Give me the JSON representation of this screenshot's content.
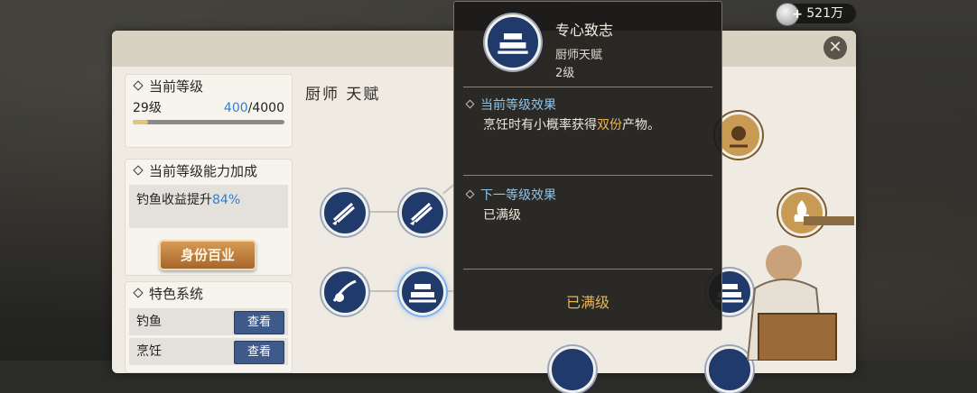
{
  "currency": {
    "amount": "521万",
    "icon": "silver-coin-icon"
  },
  "left_panel": {
    "level_card": {
      "title": "当前等级",
      "level": "29级",
      "exp_current": "400",
      "exp_sep": "/",
      "exp_max": "4000",
      "progress_fraction": 0.1
    },
    "bonus_card": {
      "title": "当前等级能力加成",
      "bonus_label": "钓鱼收益提升",
      "bonus_value": "84%"
    },
    "identity_button": "身份百业",
    "feature_card": {
      "title": "特色系统",
      "rows": [
        {
          "name": "钓鱼",
          "button": "查看"
        },
        {
          "name": "烹饪",
          "button": "查看"
        }
      ]
    }
  },
  "talent_tree": {
    "title": "厨师 天赋"
  },
  "tooltip": {
    "name": "专心致志",
    "type": "厨师天赋",
    "level": "2级",
    "current_effect_title": "当前等级效果",
    "current_effect_prefix": "烹饪时有小概率获得",
    "current_effect_highlight": "双份",
    "current_effect_suffix": "产物。",
    "next_effect_title": "下一等级效果",
    "next_effect_text": "已满级",
    "max_label": "已满级"
  },
  "colors": {
    "panel_bg": "#efebe2",
    "node_blue": "#1f3a6b",
    "accent_blue": "#2f7fd6",
    "gold": "#e8b552",
    "button_blue": "#3d5a8a"
  }
}
